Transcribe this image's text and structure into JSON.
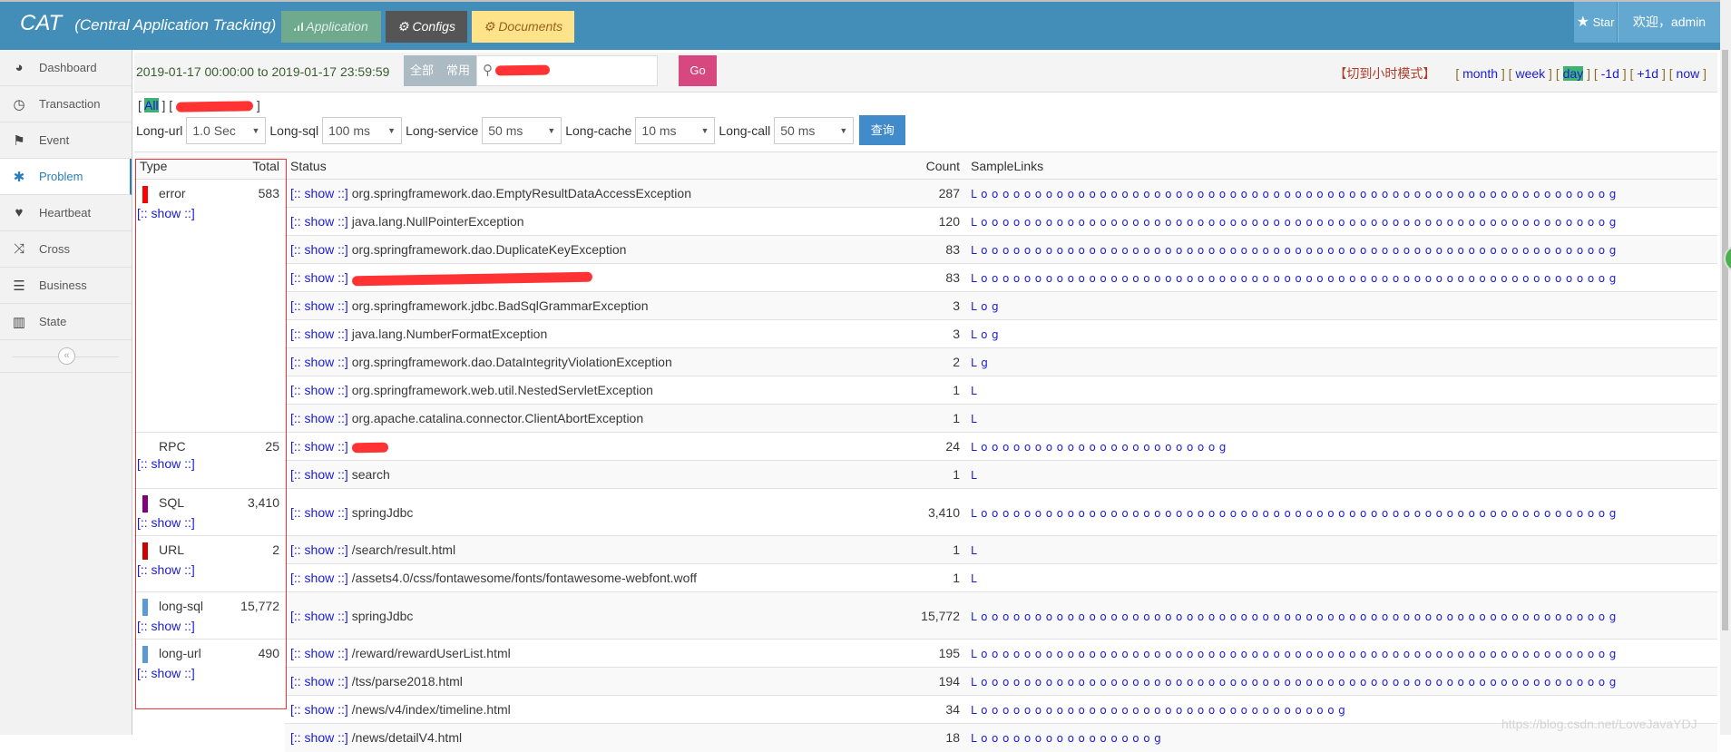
{
  "header": {
    "brand": "CAT",
    "subtitle": "(Central Application Tracking)",
    "application": "Application",
    "configs": "Configs",
    "documents": "Documents",
    "star": "Star",
    "welcome": "欢迎，admin"
  },
  "sidebar": {
    "items": [
      {
        "label": "Dashboard",
        "icon": "tachometer-icon"
      },
      {
        "label": "Transaction",
        "icon": "clock-icon"
      },
      {
        "label": "Event",
        "icon": "flag-icon"
      },
      {
        "label": "Problem",
        "icon": "bug-icon",
        "active": true
      },
      {
        "label": "Heartbeat",
        "icon": "heart-icon"
      },
      {
        "label": "Cross",
        "icon": "random-icon"
      },
      {
        "label": "Business",
        "icon": "list-icon"
      },
      {
        "label": "State",
        "icon": "bar-chart-icon"
      }
    ],
    "collapse": "«"
  },
  "topbar": {
    "date_range": "2019-01-17 00:00:00 to 2019-01-17 23:59:59",
    "all": "全部",
    "common": "常用",
    "search_value": "",
    "go": "Go",
    "mode_switch": "【切到小时模式】",
    "nav": [
      "month",
      "week",
      "day",
      "-1d",
      "+1d",
      "now"
    ],
    "nav_active": "day"
  },
  "ip_filter": {
    "all": "All"
  },
  "filters": [
    {
      "label": "Long-url",
      "value": "1.0 Sec"
    },
    {
      "label": "Long-sql",
      "value": "100 ms"
    },
    {
      "label": "Long-service",
      "value": "50 ms"
    },
    {
      "label": "Long-cache",
      "value": "10 ms"
    },
    {
      "label": "Long-call",
      "value": "50 ms"
    }
  ],
  "query_button": "查询",
  "table": {
    "headers": {
      "type": "Type",
      "total": "Total",
      "status": "Status",
      "count": "Count",
      "samples": "SampleLinks"
    },
    "show_label": "[:: show ::]",
    "groups": [
      {
        "type": "error",
        "color": "#ff0000",
        "total": "583",
        "rows": [
          {
            "status": "org.springframework.dao.EmptyResultDataAccessException",
            "count": "287",
            "samples": "Loooooooooooooooooooooooooooooooooooooooooooooooooooooooooog"
          },
          {
            "status": "java.lang.NullPointerException",
            "count": "120",
            "samples": "Loooooooooooooooooooooooooooooooooooooooooooooooooooooooooog"
          },
          {
            "status": "org.springframework.dao.DuplicateKeyException",
            "count": "83",
            "samples": "Loooooooooooooooooooooooooooooooooooooooooooooooooooooooooog"
          },
          {
            "status": "",
            "redacted": true,
            "count": "83",
            "samples": "Loooooooooooooooooooooooooooooooooooooooooooooooooooooooooog"
          },
          {
            "status": "org.springframework.jdbc.BadSqlGrammarException",
            "count": "3",
            "samples": "Log"
          },
          {
            "status": "java.lang.NumberFormatException",
            "count": "3",
            "samples": "Log"
          },
          {
            "status": "org.springframework.dao.DataIntegrityViolationException",
            "count": "2",
            "samples": "Lg"
          },
          {
            "status": "org.springframework.web.util.NestedServletException",
            "count": "1",
            "samples": "L"
          },
          {
            "status": "org.apache.catalina.connector.ClientAbortException",
            "count": "1",
            "samples": "L"
          }
        ]
      },
      {
        "type": "RPC",
        "color": "",
        "total": "25",
        "rows": [
          {
            "status": "",
            "redacted": true,
            "count": "24",
            "samples": "Loooooooooooooooooooooog"
          },
          {
            "status": "search",
            "count": "1",
            "samples": "L"
          }
        ]
      },
      {
        "type": "SQL",
        "color": "#800080",
        "total": "3,410",
        "rows": [
          {
            "status": "springJdbc",
            "count": "3,410",
            "samples": "Loooooooooooooooooooooooooooooooooooooooooooooooooooooooooog"
          }
        ]
      },
      {
        "type": "URL",
        "color": "#cc0000",
        "total": "2",
        "rows": [
          {
            "status": "/search/result.html",
            "count": "1",
            "samples": "L"
          },
          {
            "status": "/assets4.0/css/fontawesome/fonts/fontawesome-webfont.woff",
            "count": "1",
            "samples": "L"
          }
        ]
      },
      {
        "type": "long-sql",
        "color": "#5b9bd5",
        "total": "15,772",
        "rows": [
          {
            "status": "springJdbc",
            "count": "15,772",
            "samples": "Loooooooooooooooooooooooooooooooooooooooooooooooooooooooooog"
          }
        ]
      },
      {
        "type": "long-url",
        "color": "#5b9bd5",
        "total": "490",
        "rows": [
          {
            "status": "/reward/rewardUserList.html",
            "count": "195",
            "samples": "Loooooooooooooooooooooooooooooooooooooooooooooooooooooooooog"
          },
          {
            "status": "/tss/parse2018.html",
            "count": "194",
            "samples": "Loooooooooooooooooooooooooooooooooooooooooooooooooooooooooog"
          },
          {
            "status": "/news/v4/index/timeline.html",
            "count": "34",
            "samples": "Looooooooooooooooooooooooooooooooog"
          },
          {
            "status": "/news/detailV4.html",
            "count": "18",
            "samples": "Loooooooooooooooog"
          }
        ]
      }
    ]
  },
  "watermark": "https://blog.csdn.net/LoveJavaYDJ"
}
